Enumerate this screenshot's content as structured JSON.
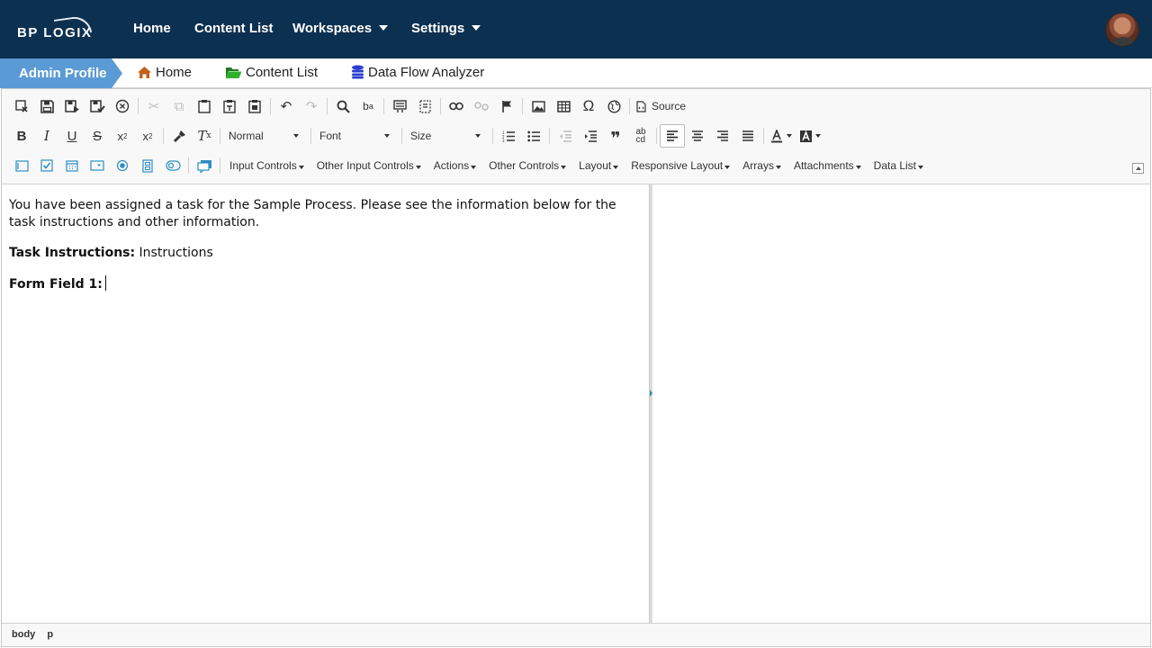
{
  "brand": {
    "logo_text": "BP LOGIX"
  },
  "topnav": {
    "home": "Home",
    "content_list": "Content List",
    "workspaces": "Workspaces",
    "settings": "Settings"
  },
  "breadcrumb": {
    "active": "Admin Profile",
    "home": "Home",
    "content_list": "Content List",
    "data_flow": "Data Flow Analyzer"
  },
  "toolbar": {
    "source_label": "Source",
    "format_combo": "Normal",
    "font_combo": "Font",
    "size_combo": "Size",
    "menus": [
      "Input Controls",
      "Other Input Controls",
      "Actions",
      "Other Controls",
      "Layout",
      "Responsive Layout",
      "Arrays",
      "Attachments",
      "Data List"
    ]
  },
  "document": {
    "intro": "You have been assigned a task for the Sample Process. Please see the information below for the task instructions and other information.",
    "task_label": "Task Instructions:",
    "task_value": "Instructions",
    "field_label": "Form Field 1:"
  },
  "statusbar": {
    "path": [
      "body",
      "p"
    ]
  },
  "colors": {
    "topbar": "#0c3050",
    "crumb_active": "#5b9bd5",
    "home_icon": "#c0621a",
    "folder_icon": "#2a9a2a",
    "db_icon": "#2b3fcf"
  }
}
